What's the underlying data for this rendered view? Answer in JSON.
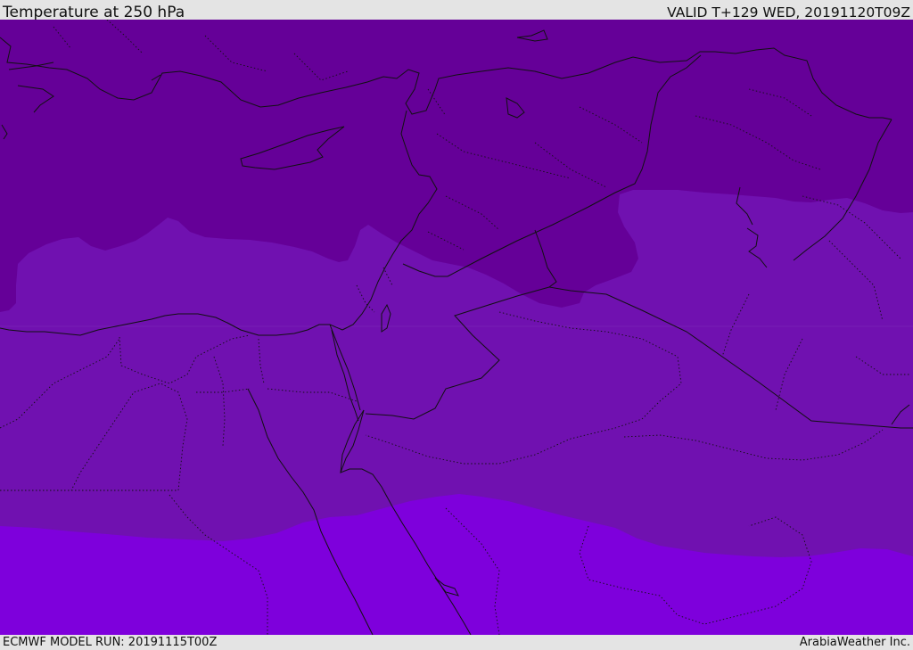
{
  "header": {
    "title": "Temperature at 250 hPa",
    "valid_time": "VALID T+129 WED, 20191120T09Z"
  },
  "footer": {
    "model_run": "ECMWF MODEL RUN: 20191115T00Z",
    "credit": "ArabiaWeather Inc."
  },
  "map": {
    "field": "temperature",
    "level": "250 hPa",
    "band_colors": {
      "north": "#650098",
      "middle": "#7011b0",
      "south": "#7e00dc"
    },
    "coastline_color": "#111111",
    "border_color": "#111111"
  }
}
